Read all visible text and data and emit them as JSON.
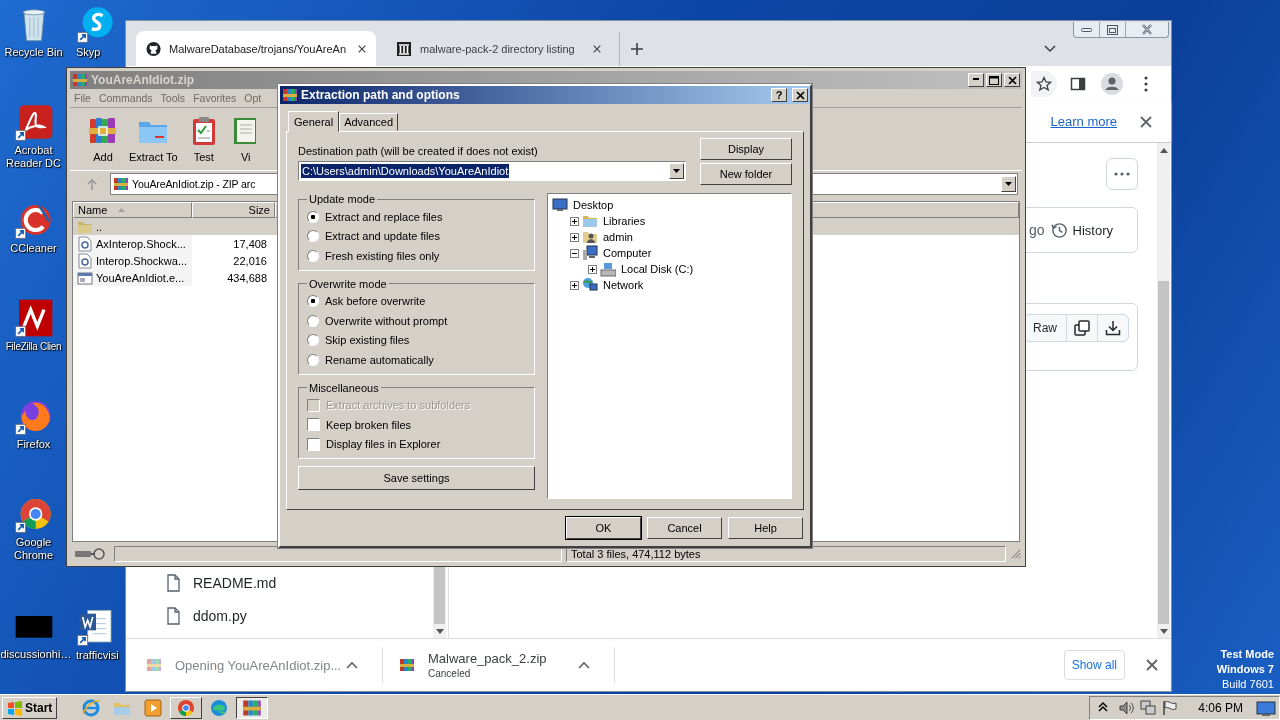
{
  "desktop": {
    "columns": [
      {
        "icons": [
          {
            "label": "Recycle Bin",
            "kind": "recycle"
          },
          {
            "label": "Acrobat Reader DC",
            "kind": "acrobat"
          },
          {
            "label": "CCleaner",
            "kind": "ccleaner"
          },
          {
            "label": "FileZilla Clien",
            "kind": "filezilla"
          },
          {
            "label": "Firefox",
            "kind": "firefox"
          },
          {
            "label": "Google Chrome",
            "kind": "chrome"
          },
          {
            "label": "discussionhi…",
            "kind": "blackfile"
          }
        ]
      },
      {
        "icons": [
          {
            "label": "Skyp",
            "kind": "skype"
          },
          {
            "label": "trafficvisi",
            "kind": "word"
          }
        ]
      }
    ],
    "system_text": [
      "Test Mode",
      "Windows 7",
      "Build 7601"
    ]
  },
  "browser": {
    "tabs": [
      {
        "title": "MalwareDatabase/trojans/YouAreAn",
        "kind": "github",
        "selected": true
      },
      {
        "title": "malware-pack-2 directory listing",
        "kind": "archive",
        "selected": false
      }
    ],
    "infobar_link": "Learn more",
    "content": {
      "file_list": [
        "README.md",
        "ddom.py"
      ],
      "partial_text": "go",
      "history_button": "History",
      "raw_button": "Raw"
    },
    "downloads": [
      {
        "name": "Opening YouAreAnIdiot.zip...",
        "dimmed": true
      },
      {
        "name": "Malware_pack_2.zip",
        "status": "Canceled",
        "dimmed": false
      }
    ],
    "show_all": "Show all"
  },
  "archiver": {
    "title": "YouAreAnIdiot.zip",
    "menu": [
      "File",
      "Commands",
      "Tools",
      "Favorites",
      "Opt"
    ],
    "toolbar": [
      {
        "label": "Add",
        "kind": "add"
      },
      {
        "label": "Extract To",
        "kind": "extract"
      },
      {
        "label": "Test",
        "kind": "test"
      },
      {
        "label": "Vi",
        "kind": "view"
      }
    ],
    "address": "YouAreAnIdiot.zip - ZIP arc",
    "columns": [
      "Name",
      "Size"
    ],
    "rows": [
      {
        "name": "..",
        "kind": "up",
        "selected": true
      },
      {
        "name": "AxInterop.Shock...",
        "size": "17,408",
        "kind": "dll",
        "selected": false
      },
      {
        "name": "Interop.Shockwa...",
        "size": "22,016",
        "kind": "dll",
        "selected": false
      },
      {
        "name": "YouAreAnIdiot.e...",
        "size": "434,688",
        "kind": "exe",
        "selected": false
      }
    ],
    "status": "Total 3 files, 474,112 bytes"
  },
  "dialog": {
    "title": "Extraction path and options",
    "help": "?",
    "tabs": [
      {
        "label": "General",
        "selected": true
      },
      {
        "label": "Advanced",
        "selected": false
      }
    ],
    "destination": {
      "label": "Destination path (will be created if does not exist)",
      "value": "C:\\Users\\admin\\Downloads\\YouAreAnIdiot",
      "highlighted": true
    },
    "side_buttons": [
      "Display",
      "New folder"
    ],
    "groups": [
      {
        "title": "Update mode",
        "kind": "radio",
        "options": [
          {
            "label": "Extract and replace files",
            "selected": true
          },
          {
            "label": "Extract and update files",
            "selected": false
          },
          {
            "label": "Fresh existing files only",
            "selected": false
          }
        ]
      },
      {
        "title": "Overwrite mode",
        "kind": "radio",
        "options": [
          {
            "label": "Ask before overwrite",
            "selected": true
          },
          {
            "label": "Overwrite without prompt",
            "selected": false
          },
          {
            "label": "Skip existing files",
            "selected": false
          },
          {
            "label": "Rename automatically",
            "selected": false
          }
        ]
      },
      {
        "title": "Miscellaneous",
        "kind": "checkbox",
        "options": [
          {
            "label": "Extract archives to subfolders",
            "checked": false,
            "disabled": true
          },
          {
            "label": "Keep broken files",
            "checked": false,
            "disabled": false
          },
          {
            "label": "Display files in Explorer",
            "checked": false,
            "disabled": false
          }
        ]
      }
    ],
    "save_button": "Save settings",
    "tree": [
      {
        "label": "Desktop",
        "kind": "desktop",
        "children": [
          {
            "label": "Libraries",
            "kind": "library",
            "expanded": false
          },
          {
            "label": "admin",
            "kind": "user",
            "expanded": false
          },
          {
            "label": "Computer",
            "kind": "computer",
            "expanded": true,
            "children": [
              {
                "label": "Local Disk (C:)",
                "kind": "disk",
                "expanded": false
              }
            ]
          },
          {
            "label": "Network",
            "kind": "network",
            "expanded": false
          }
        ]
      }
    ],
    "buttons": [
      {
        "label": "OK",
        "default": true
      },
      {
        "label": "Cancel",
        "default": false
      },
      {
        "label": "Help",
        "default": false
      }
    ]
  },
  "taskbar": {
    "start": "Start",
    "apps": [
      {
        "kind": "ie",
        "running": false,
        "active": false
      },
      {
        "kind": "explorer",
        "running": false,
        "active": false
      },
      {
        "kind": "media",
        "running": false,
        "active": false
      },
      {
        "kind": "chrome",
        "running": true,
        "active": false
      },
      {
        "kind": "edge",
        "running": false,
        "active": false
      },
      {
        "kind": "winrar",
        "running": true,
        "active": true
      }
    ],
    "time": "4:06 PM"
  }
}
